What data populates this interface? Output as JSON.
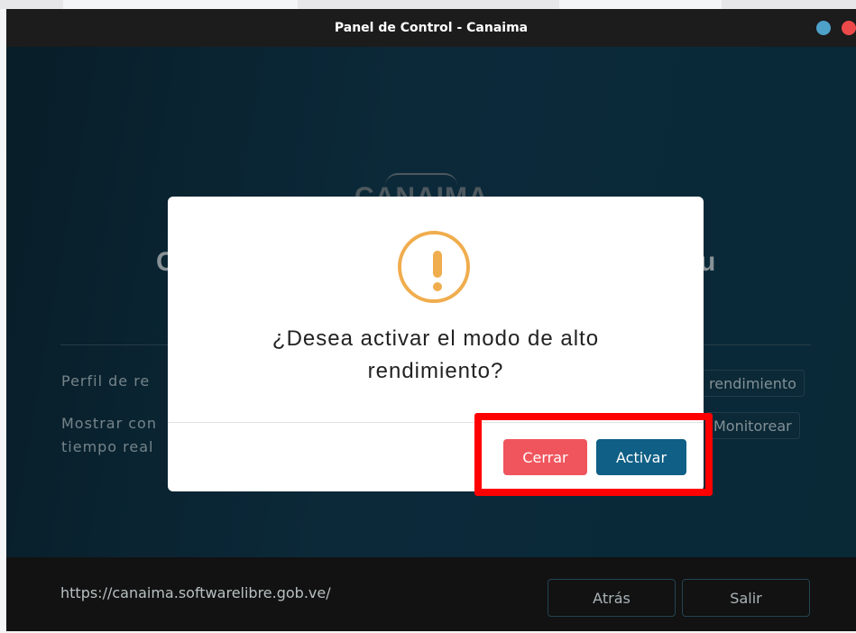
{
  "window": {
    "title": "Panel de Control - Canaima"
  },
  "background": {
    "logo_text": "CANAIMA",
    "heading_left": "C",
    "heading_right": "u",
    "rows": [
      {
        "label_line1": "Perfil de re",
        "label_line2": "",
        "button_label": "rendimiento"
      },
      {
        "label_line1": "Mostrar con",
        "label_line2": "tiempo real",
        "button_label": "Monitorear"
      }
    ]
  },
  "dialog": {
    "question_line1": "¿Desea activar el modo de alto",
    "question_line2": "rendimiento?",
    "icon": "warning-icon",
    "cerrar_label": "Cerrar",
    "activar_label": "Activar"
  },
  "footer": {
    "url": "https://canaima.softwarelibre.gob.ve/",
    "back_label": "Atrás",
    "exit_label": "Salir"
  },
  "colors": {
    "cerrar": "#f0555d",
    "activar": "#0f5f86",
    "warning": "#f0ad4e",
    "highlight": "#ff0000"
  }
}
